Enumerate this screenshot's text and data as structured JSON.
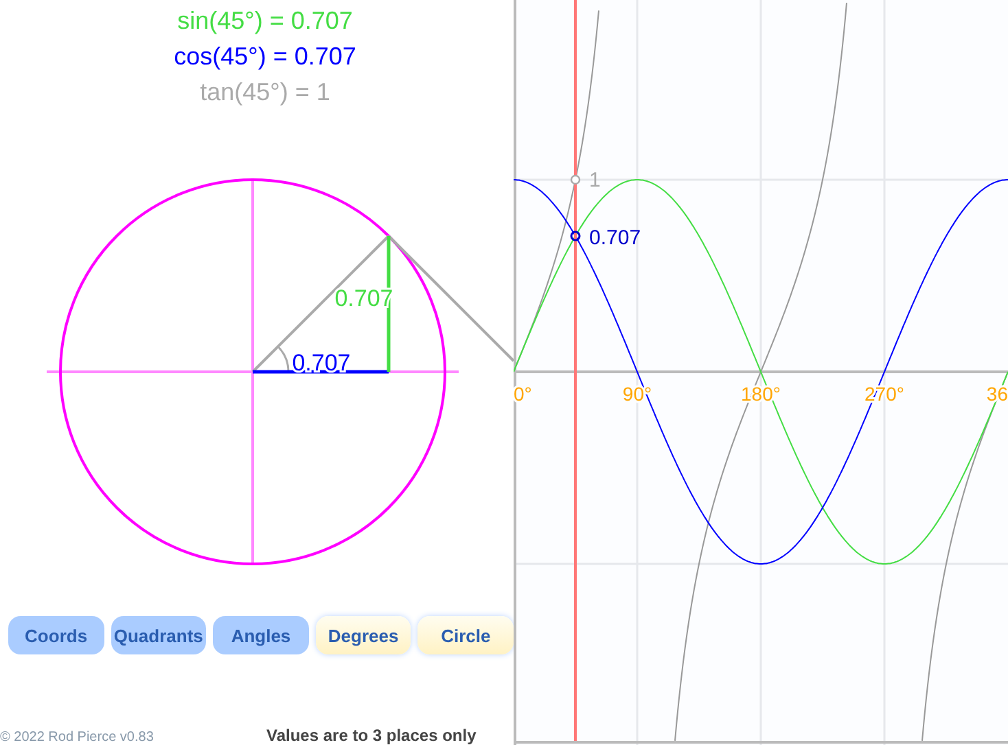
{
  "readouts": [
    {
      "text": "sin(45°) = 0.707",
      "color": "#44dd44"
    },
    {
      "text": "cos(45°) = 0.707",
      "color": "#0000ff"
    },
    {
      "text": "tan(45°) = 1",
      "color": "#aaaaaa"
    }
  ],
  "circle": {
    "sin_label": "0.707",
    "cos_label": "0.707"
  },
  "graph": {
    "tan_point_label": "1",
    "cos_point_label": "0.707",
    "x_tick_labels": [
      "0°",
      "90°",
      "180°",
      "270°",
      "36"
    ]
  },
  "buttons": [
    {
      "label": "Coords",
      "on": false
    },
    {
      "label": "Quadrants",
      "on": false
    },
    {
      "label": "Angles",
      "on": false
    },
    {
      "label": "Degrees",
      "on": true
    },
    {
      "label": "Circle",
      "on": true
    }
  ],
  "footer": {
    "copyright": "© 2022 Rod Pierce v0.83",
    "note": "Values are to 3 places only"
  }
}
